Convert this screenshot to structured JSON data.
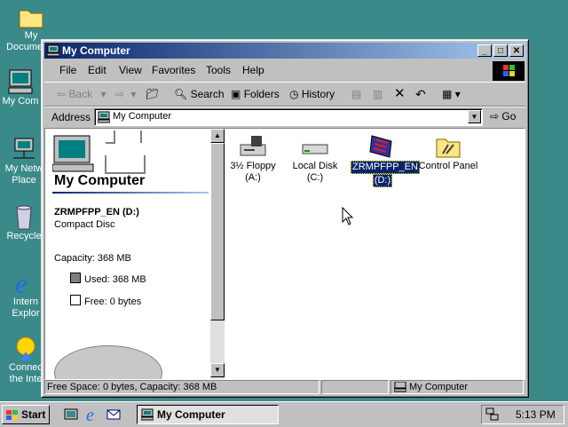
{
  "desktop": {
    "icons": [
      {
        "label1": "My Documents",
        "label2": ""
      },
      {
        "label1": "My Com",
        "label2": ""
      },
      {
        "label1": "My Netw",
        "label2": "Place"
      },
      {
        "label1": "Recycle",
        "label2": ""
      },
      {
        "label1": "Intern",
        "label2": "Explor"
      },
      {
        "label1": "Connec",
        "label2": "the Inte"
      }
    ]
  },
  "window": {
    "title": "My Computer",
    "menu": [
      "File",
      "Edit",
      "View",
      "Favorites",
      "Tools",
      "Help"
    ],
    "toolbar": {
      "back": "Back",
      "search": "Search",
      "folders": "Folders",
      "history": "History"
    },
    "address_label": "Address",
    "address_value": "My Computer",
    "go_label": "Go"
  },
  "leftpane": {
    "heading": "My Computer",
    "selected_name": "ZRMPFPP_EN (D:)",
    "selected_type": "Compact Disc",
    "capacity": "Capacity: 368 MB",
    "used": "Used: 368 MB",
    "free": "Free: 0 bytes"
  },
  "items": [
    {
      "line1": "3½ Floppy",
      "line2": "(A:)",
      "icon": "floppy-drive-icon",
      "selected": false
    },
    {
      "line1": "Local Disk (C:)",
      "line2": "",
      "icon": "hard-disk-icon",
      "selected": false
    },
    {
      "line1": "ZRMPFPP_EN",
      "line2": "(D:)",
      "icon": "cd-drive-icon",
      "selected": true
    },
    {
      "line1": "Control Panel",
      "line2": "",
      "icon": "control-panel-icon",
      "selected": false
    }
  ],
  "statusbar": {
    "left": "Free Space: 0 bytes, Capacity: 368 MB",
    "right": "My Computer"
  },
  "taskbar": {
    "start": "Start",
    "task": "My Computer",
    "clock": "5:13 PM"
  },
  "colors": {
    "desktop": "#3a8a8a",
    "title_active": "#0a246a",
    "selection": "#0a246a"
  }
}
